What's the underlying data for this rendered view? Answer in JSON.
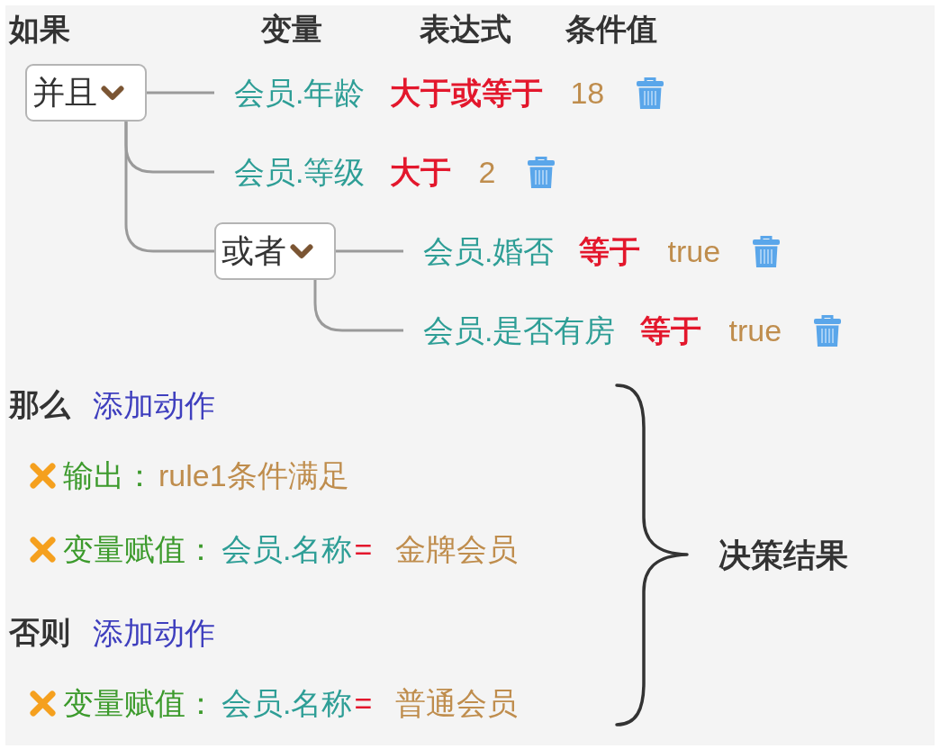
{
  "header": {
    "title": "如果",
    "columns": [
      "变量",
      "表达式",
      "条件值"
    ]
  },
  "conditions": {
    "junction": "并且",
    "children": [
      {
        "kind": "condition",
        "variable": "会员.年龄",
        "operator": "大于或等于",
        "value": "18"
      },
      {
        "kind": "condition",
        "variable": "会员.等级",
        "operator": "大于",
        "value": "2"
      },
      {
        "kind": "group",
        "junction": "或者",
        "children": [
          {
            "kind": "condition",
            "variable": "会员.婚否",
            "operator": "等于",
            "value": "true"
          },
          {
            "kind": "condition",
            "variable": "会员.是否有房",
            "operator": "等于",
            "value": "true"
          }
        ]
      }
    ]
  },
  "branches": [
    {
      "title": "那么",
      "add_action": "添加动作",
      "actions": [
        {
          "kind": "output",
          "label": "输出：",
          "value": "rule1条件满足"
        },
        {
          "kind": "assign",
          "label": "变量赋值：",
          "variable": "会员.名称",
          "operator": "=",
          "value": "金牌会员"
        }
      ]
    },
    {
      "title": "否则",
      "add_action": "添加动作",
      "actions": [
        {
          "kind": "assign",
          "label": "变量赋值：",
          "variable": "会员.名称",
          "operator": "=",
          "value": "普通会员"
        }
      ]
    }
  ],
  "annotation": {
    "label": "决策结果"
  }
}
